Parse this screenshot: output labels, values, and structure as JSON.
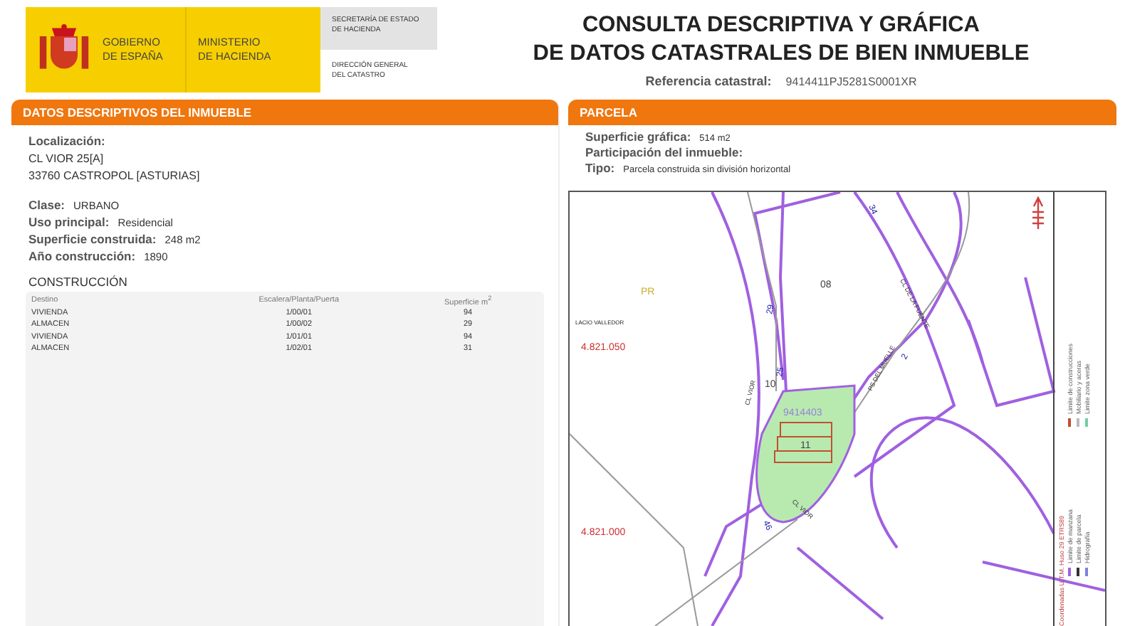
{
  "header": {
    "logo_left": [
      "GOBIERNO",
      "DE ESPAÑA"
    ],
    "logo_ministry": [
      "MINISTERIO",
      "DE HACIENDA"
    ],
    "secretaria": [
      "SECRETARÍA DE ESTADO",
      "DE HACIENDA"
    ],
    "direccion": [
      "DIRECCIÓN GENERAL",
      "DEL CATASTRO"
    ]
  },
  "title": [
    "CONSULTA DESCRIPTIVA Y GRÁFICA",
    "DE DATOS CATASTRALES DE BIEN INMUEBLE"
  ],
  "reference": {
    "label": "Referencia catastral:",
    "value": "9414411PJ5281S0001XR"
  },
  "descriptive": {
    "title": "DATOS DESCRIPTIVOS DEL INMUEBLE",
    "location_label": "Localización:",
    "address": [
      "CL VIOR 25[A]",
      "33760 CASTROPOL [ASTURIAS]"
    ],
    "fields": [
      {
        "label": "Clase:",
        "value": "URBANO"
      },
      {
        "label": "Uso principal:",
        "value": "Residencial"
      },
      {
        "label": "Superficie construida:",
        "value": "248 m2"
      },
      {
        "label": "Año construcción:",
        "value": "1890"
      }
    ],
    "construction_title": "CONSTRUCCIÓN",
    "columns": [
      "Destino",
      "Escalera/Planta/Puerta",
      "Superficie m$^{2}$"
    ],
    "rows": [
      [
        "VIVIENDA",
        "1/00/01",
        "94"
      ],
      [
        "ALMACEN",
        "1/00/02",
        "29"
      ],
      [
        "VIVIENDA",
        "1/01/01",
        "94"
      ],
      [
        "ALMACEN",
        "1/02/01",
        "31"
      ]
    ]
  },
  "parcel": {
    "title": "PARCELA",
    "fields": [
      {
        "label": "Superficie gráfica:",
        "value": "514 m2"
      },
      {
        "label": "Participación del inmueble:"
      },
      {
        "label": "Tipo:",
        "value": "Parcela construida sin división horizontal"
      }
    ]
  },
  "map": {
    "labels": [
      {
        "kind": "zone",
        "text": "PR"
      },
      {
        "kind": "block",
        "text": "08"
      },
      {
        "kind": "place",
        "text": "LACIO VALLEDOR"
      },
      {
        "kind": "coord",
        "text": "4.821.050"
      },
      {
        "kind": "block",
        "text": "10"
      },
      {
        "kind": "parcel",
        "text": "9414403"
      },
      {
        "kind": "block",
        "text": "11"
      },
      {
        "kind": "coord",
        "text": "4.821.000"
      },
      {
        "kind": "street",
        "text": "CL DE LA FUENTE"
      },
      {
        "kind": "street",
        "text": "PS DEL MUELLE"
      },
      {
        "kind": "street",
        "text": "CL VIOR"
      },
      {
        "kind": "street",
        "text": "CL VIOR"
      },
      {
        "kind": "number",
        "text": "29"
      },
      {
        "kind": "number",
        "text": "25"
      },
      {
        "kind": "number",
        "text": "2"
      },
      {
        "kind": "number",
        "text": "34"
      },
      {
        "kind": "number",
        "text": "46"
      }
    ],
    "legend": [
      {
        "text": "Limite de manzana",
        "color": "#a060e0"
      },
      {
        "text": "Limite de construcciones",
        "color": "#c05030"
      },
      {
        "text": "Limite de parcela",
        "color": "#333333"
      },
      {
        "text": "Mobiliario y aceras",
        "color": "#bbbbbb"
      },
      {
        "text": "Hidrografía",
        "color": "#8080e0"
      },
      {
        "text": "Limite zona verde",
        "color": "#70d0a0"
      }
    ],
    "coords_note": "Coordenadas U.T.M. Huso 29 ETRS89"
  }
}
